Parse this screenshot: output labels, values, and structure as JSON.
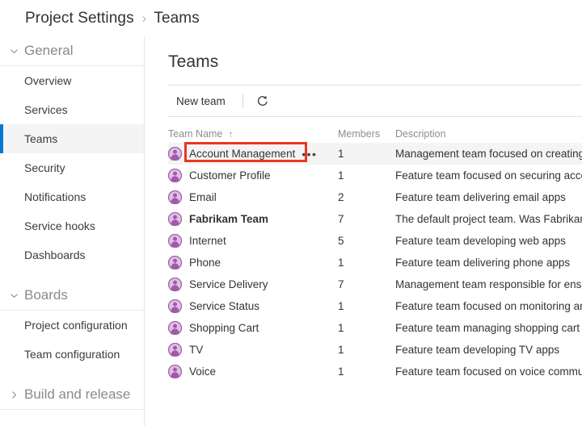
{
  "breadcrumb": {
    "root": "Project Settings",
    "separator": "›",
    "current": "Teams"
  },
  "sidebar": {
    "groups": [
      {
        "title": "General",
        "chevron": "chevron-down",
        "expanded": true,
        "items": [
          {
            "label": "Overview",
            "selected": false
          },
          {
            "label": "Services",
            "selected": false
          },
          {
            "label": "Teams",
            "selected": true
          },
          {
            "label": "Security",
            "selected": false
          },
          {
            "label": "Notifications",
            "selected": false
          },
          {
            "label": "Service hooks",
            "selected": false
          },
          {
            "label": "Dashboards",
            "selected": false
          }
        ]
      },
      {
        "title": "Boards",
        "chevron": "chevron-down",
        "expanded": true,
        "items": [
          {
            "label": "Project configuration",
            "selected": false
          },
          {
            "label": "Team configuration",
            "selected": false
          }
        ]
      },
      {
        "title": "Build and release",
        "chevron": "chevron-right",
        "expanded": false,
        "items": []
      }
    ]
  },
  "main": {
    "title": "Teams",
    "toolbar": {
      "new_team_label": "New team",
      "refresh_icon": "refresh-icon"
    },
    "table": {
      "columns": {
        "name": "Team Name",
        "members": "Members",
        "description": "Description"
      },
      "sort": {
        "column": "Team Name",
        "direction": "ascending",
        "glyph": "↑"
      },
      "rows": [
        {
          "name": "Account Management",
          "members": "1",
          "description": "Management team focused on creating an",
          "bold": false,
          "hovered": true,
          "annotated": true,
          "menu": "•••"
        },
        {
          "name": "Customer Profile",
          "members": "1",
          "description": "Feature team focused on securing account",
          "bold": false,
          "hovered": false,
          "annotated": false
        },
        {
          "name": "Email",
          "members": "2",
          "description": "Feature team delivering email apps",
          "bold": false,
          "hovered": false,
          "annotated": false
        },
        {
          "name": "Fabrikam Team",
          "members": "7",
          "description": "The default project team. Was Fabrikam Fi",
          "bold": true,
          "hovered": false,
          "annotated": false
        },
        {
          "name": "Internet",
          "members": "5",
          "description": "Feature team developing web apps",
          "bold": false,
          "hovered": false,
          "annotated": false
        },
        {
          "name": "Phone",
          "members": "1",
          "description": "Feature team delivering phone apps",
          "bold": false,
          "hovered": false,
          "annotated": false
        },
        {
          "name": "Service Delivery",
          "members": "7",
          "description": "Management team responsible for ensure",
          "bold": false,
          "hovered": false,
          "annotated": false
        },
        {
          "name": "Service Status",
          "members": "1",
          "description": "Feature team focused on monitoring and ",
          "bold": false,
          "hovered": false,
          "annotated": false
        },
        {
          "name": "Shopping Cart",
          "members": "1",
          "description": "Feature team managing shopping cart app",
          "bold": false,
          "hovered": false,
          "annotated": false
        },
        {
          "name": "TV",
          "members": "1",
          "description": "Feature team developing TV apps",
          "bold": false,
          "hovered": false,
          "annotated": false
        },
        {
          "name": "Voice",
          "members": "1",
          "description": "Feature team focused on voice communic",
          "bold": false,
          "hovered": false,
          "annotated": false
        }
      ]
    }
  },
  "colors": {
    "accent": "#0078d4",
    "annotation": "#e8381f",
    "team_icon": "#a05aa8",
    "row_hover": "#f4f4f4",
    "text": "#333333",
    "muted": "#8e8e8e"
  }
}
